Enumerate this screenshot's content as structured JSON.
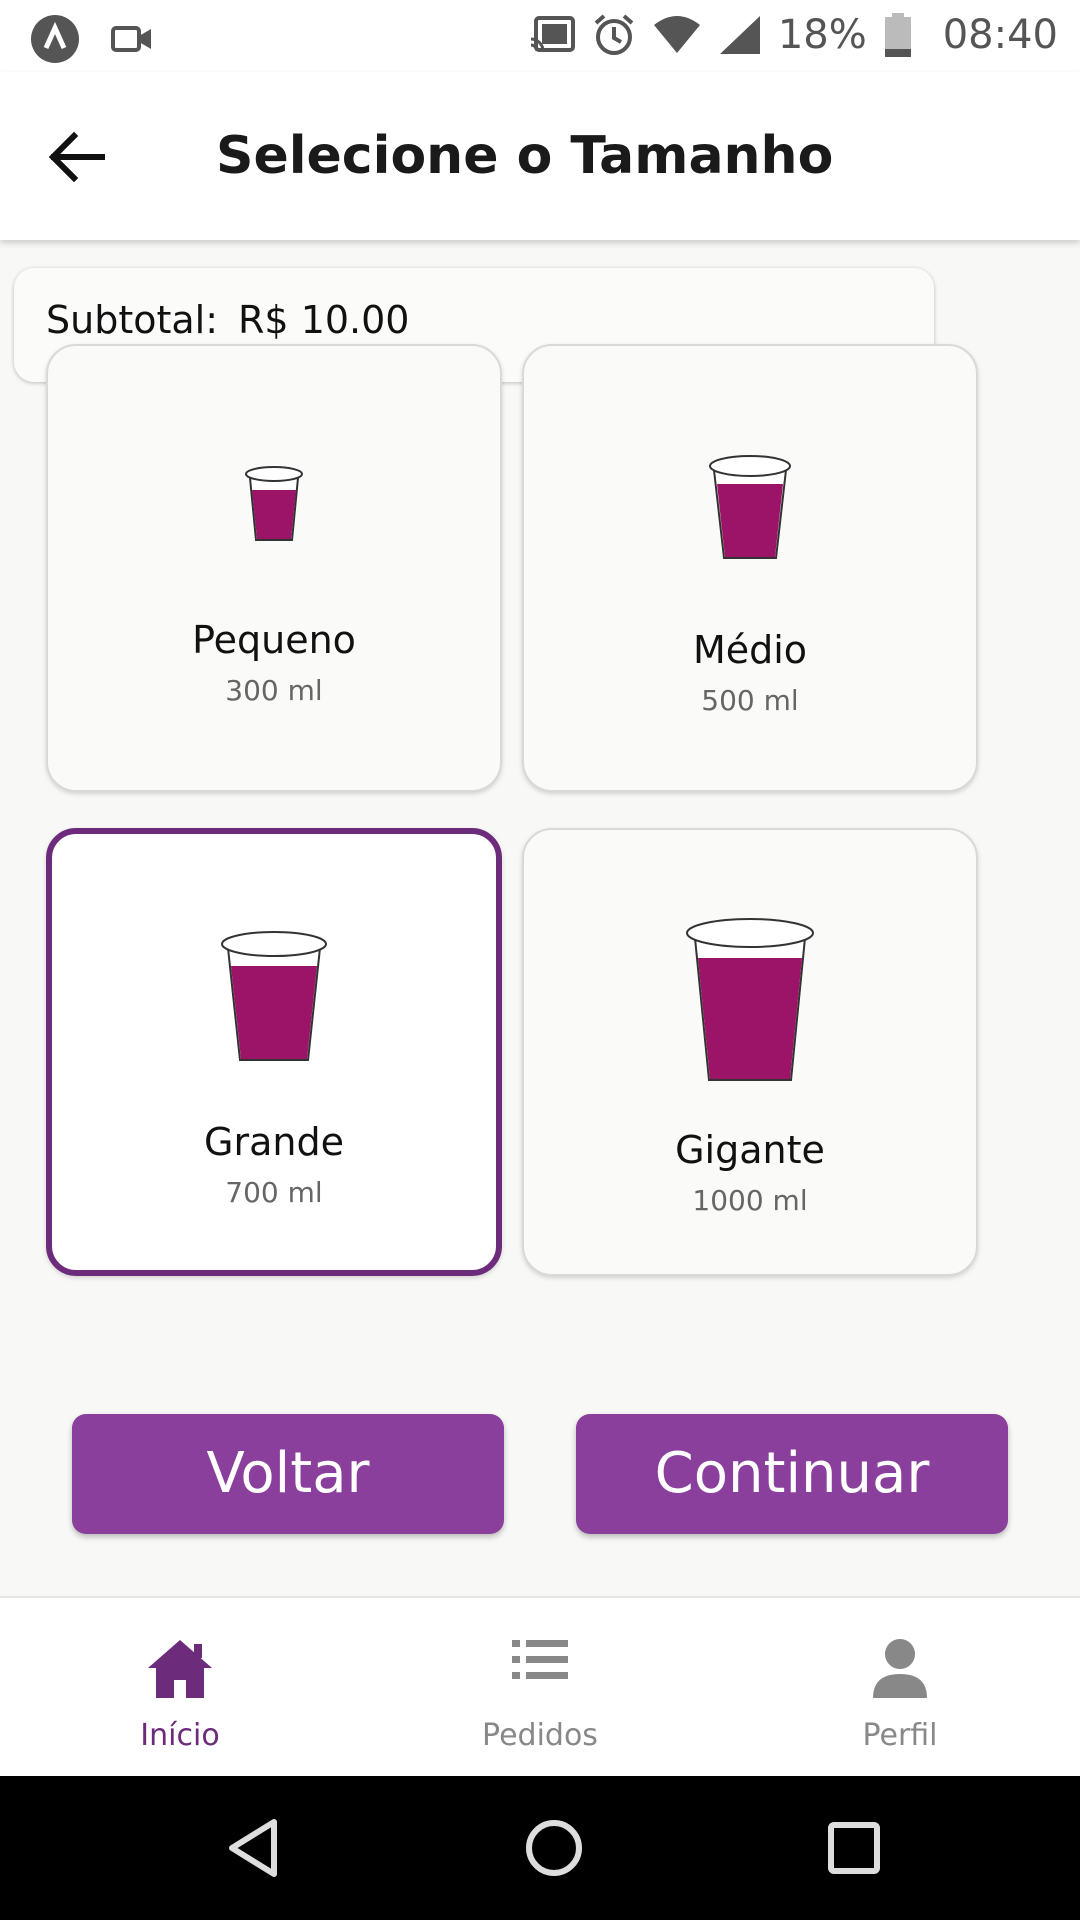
{
  "status_bar": {
    "battery": "18%",
    "time": "08:40",
    "icons": [
      "app-notification-icon",
      "video-camera-icon",
      "cast-icon",
      "alarm-icon",
      "wifi-icon",
      "signal-icon",
      "battery-icon"
    ]
  },
  "header": {
    "title": "Selecione o Tamanho",
    "back_icon": "arrow-left-icon"
  },
  "subtotal": {
    "label": "Subtotal:",
    "value": "R$ 10.00"
  },
  "sizes": [
    {
      "name": "Pequeno",
      "volume": "300 ml",
      "selected": false
    },
    {
      "name": "Médio",
      "volume": "500 ml",
      "selected": false
    },
    {
      "name": "Grande",
      "volume": "700 ml",
      "selected": true
    },
    {
      "name": "Gigante",
      "volume": "1000 ml",
      "selected": false
    }
  ],
  "buttons": {
    "back_label": "Voltar",
    "continue_label": "Continuar"
  },
  "bottom_nav": {
    "items": [
      {
        "label": "Início",
        "icon": "home-icon",
        "active": true
      },
      {
        "label": "Pedidos",
        "icon": "list-icon",
        "active": false
      },
      {
        "label": "Perfil",
        "icon": "person-icon",
        "active": false
      }
    ]
  },
  "colors": {
    "accent": "#8b3f9c",
    "selected_border": "#6d2b7b",
    "juice": "#9c1468"
  }
}
